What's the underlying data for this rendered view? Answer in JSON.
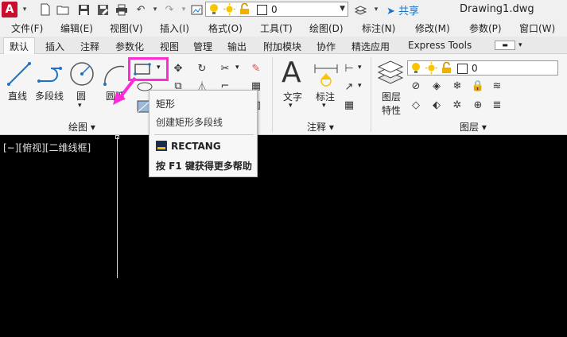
{
  "titlebar": {
    "logo": "A",
    "layer_value": "0",
    "share_label": "共享",
    "doc_title": "Drawing1.dwg",
    "icons": [
      "new-file-icon",
      "open-folder-icon",
      "save-icon",
      "save-as-icon",
      "print-icon",
      "undo-icon",
      "redo-icon",
      "plot-icon",
      "lightbulb-icon",
      "sun-icon",
      "lock-icon"
    ]
  },
  "menu": [
    "文件(F)",
    "编辑(E)",
    "视图(V)",
    "插入(I)",
    "格式(O)",
    "工具(T)",
    "绘图(D)",
    "标注(N)",
    "修改(M)",
    "参数(P)",
    "窗口(W)"
  ],
  "tabs": [
    "默认",
    "插入",
    "注释",
    "参数化",
    "视图",
    "管理",
    "输出",
    "附加模块",
    "协作",
    "精选应用",
    "Express Tools"
  ],
  "ribbon": {
    "draw": {
      "line": "直线",
      "polyline": "多段线",
      "circle": "圆",
      "arc": "圆弧",
      "panel_title": "绘图 ▾"
    },
    "annotation": {
      "text": "文字",
      "dimension": "标注",
      "text_glyph": "A",
      "panel_title": "注释 ▾"
    },
    "layers": {
      "layer_props_line1": "图层",
      "layer_props_line2": "特性",
      "layer_value": "0",
      "panel_title": "图层 ▾"
    }
  },
  "tooltip": {
    "title": "矩形",
    "description": "创建矩形多段线",
    "command": "RECTANG",
    "help": "按 F1 键获得更多帮助"
  },
  "viewport": {
    "label": "[−][俯视][二维线框]"
  },
  "colors": {
    "highlight": "#ff2bd8",
    "share": "#1a73c9",
    "canvas": "#000000"
  }
}
